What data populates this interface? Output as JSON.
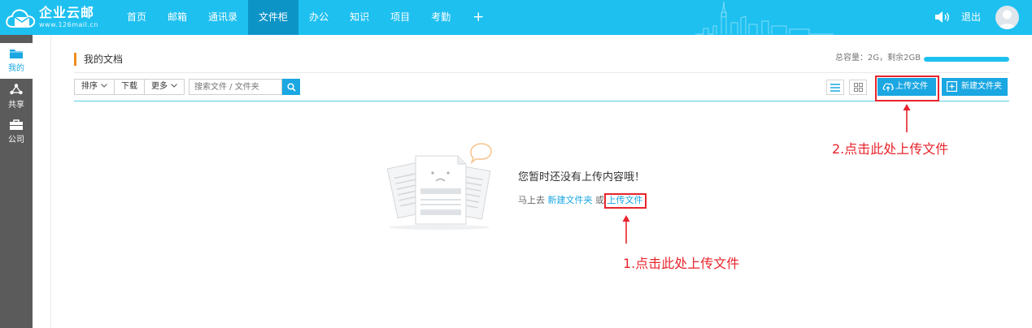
{
  "header": {
    "brand": "企业云邮",
    "brand_url": "www.126mail.cn",
    "nav": [
      {
        "label": "首页"
      },
      {
        "label": "邮箱"
      },
      {
        "label": "通讯录"
      },
      {
        "label": "文件柜"
      },
      {
        "label": "办公"
      },
      {
        "label": "知识"
      },
      {
        "label": "项目"
      },
      {
        "label": "考勤"
      }
    ],
    "active_nav": "文件柜",
    "plus": "+",
    "logout": "退出",
    "colors": {
      "bar": "#1ec0f0",
      "active_tab": "#0d94c7"
    }
  },
  "sidebar": {
    "items": [
      {
        "label": "我的",
        "icon": "folder-icon",
        "active": true
      },
      {
        "label": "共享",
        "icon": "share-icon",
        "active": false
      },
      {
        "label": "公司",
        "icon": "briefcase-icon",
        "active": false
      }
    ]
  },
  "main": {
    "title": "我的文档",
    "capacity_text": "总容量：2G，剩余2GB",
    "capacity_remaining_fraction": 1.0,
    "toolbar": {
      "sort": "排序",
      "download": "下载",
      "more": "更多",
      "search_placeholder": "搜索文件 / 文件夹"
    },
    "upload_button": "上传文件",
    "new_folder_button": "新建文件夹",
    "empty": {
      "message": "您暂时还没有上传内容哦！",
      "prefix": "马上去",
      "new_folder_link": "新建文件夹",
      "or": "或",
      "upload_link": "上传文件"
    }
  },
  "annotations": {
    "step1": "1.点击此处上传文件",
    "step2": "2.点击此处上传文件",
    "color": "#e8242c"
  }
}
